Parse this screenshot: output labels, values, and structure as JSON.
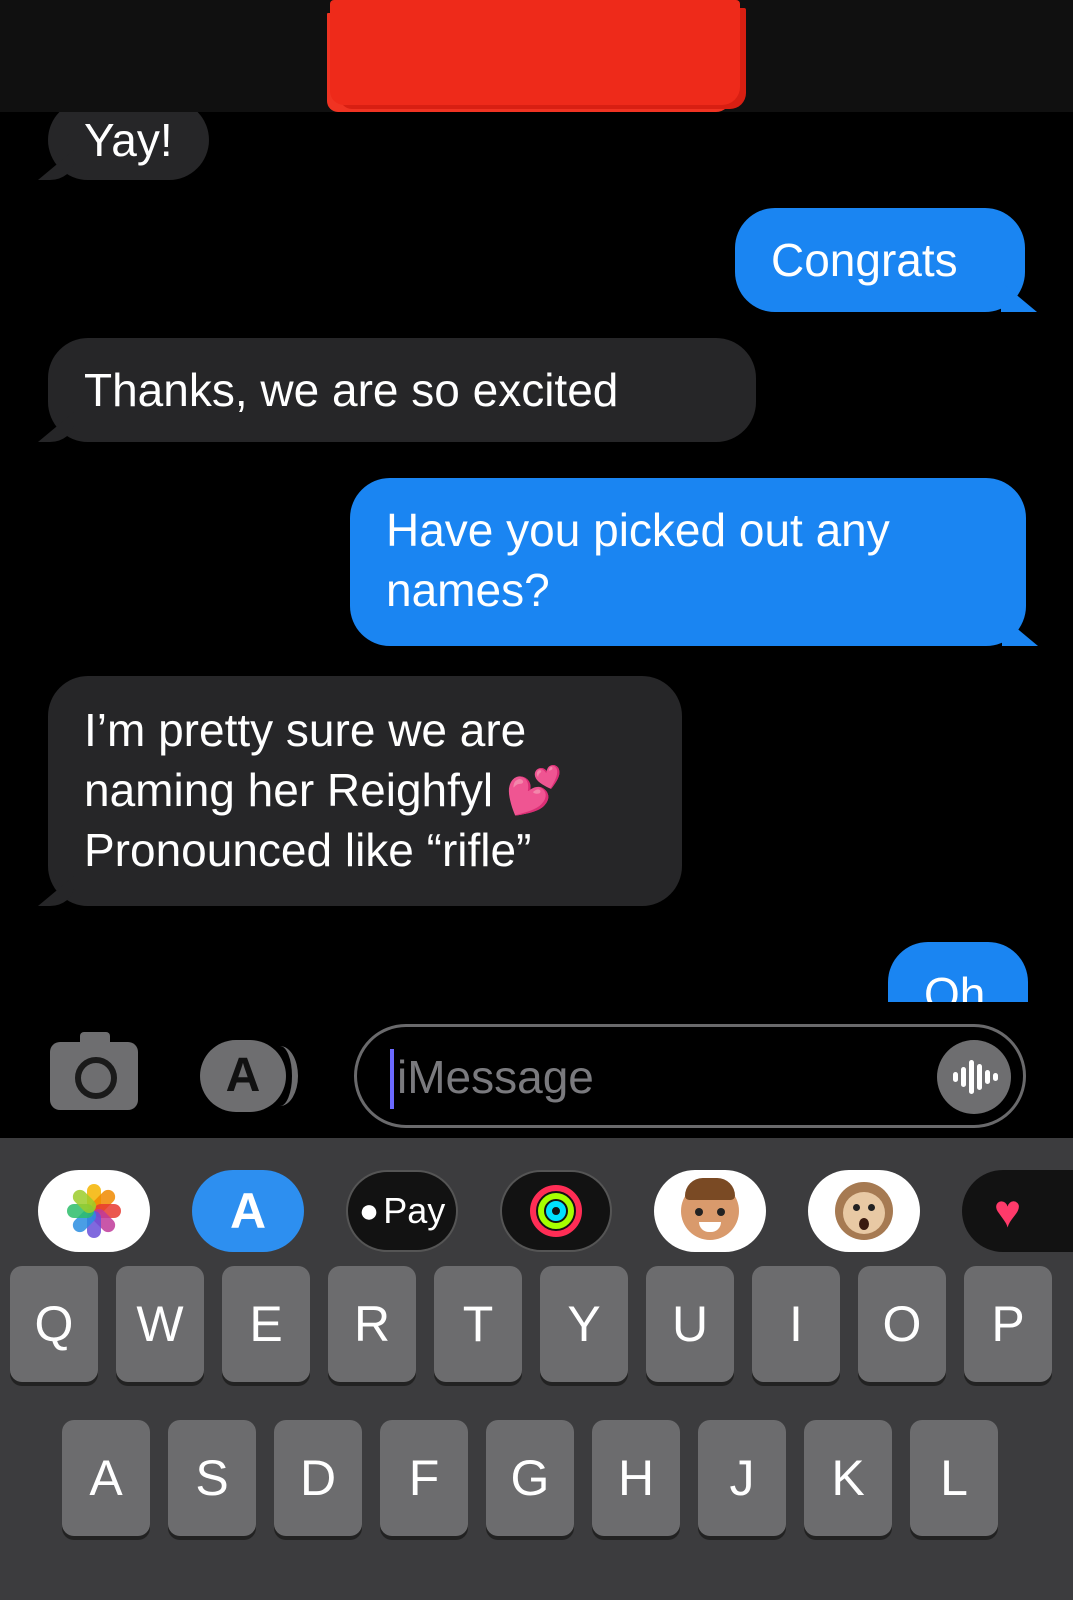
{
  "conversation": {
    "messages": [
      {
        "direction": "incoming",
        "text": "Yay!"
      },
      {
        "direction": "outgoing",
        "text": "Congrats"
      },
      {
        "direction": "incoming",
        "text": "Thanks, we are so excited"
      },
      {
        "direction": "outgoing",
        "text": "Have you picked out any names?"
      },
      {
        "direction": "incoming",
        "text": "I’m pretty sure we are naming her Reighfyl 💕 Pronounced like “rifle”"
      },
      {
        "direction": "outgoing",
        "text": "Oh"
      }
    ]
  },
  "input_bar": {
    "placeholder": "iMessage",
    "camera_icon": "camera-icon",
    "apps_icon": "app-store-icon",
    "voice_icon": "waveform-icon"
  },
  "app_drawer": {
    "apps": [
      {
        "name": "photos-icon"
      },
      {
        "name": "app-store-icon"
      },
      {
        "name": "apple-pay-icon",
        "label": "Pay"
      },
      {
        "name": "activity-rings-icon"
      },
      {
        "name": "memoji-icon"
      },
      {
        "name": "animoji-monkey-icon"
      },
      {
        "name": "digital-touch-heart-icon"
      }
    ]
  },
  "keyboard": {
    "row1": [
      "Q",
      "W",
      "E",
      "R",
      "T",
      "Y",
      "U",
      "I",
      "O",
      "P"
    ],
    "row2": [
      "A",
      "S",
      "D",
      "F",
      "G",
      "H",
      "J",
      "K",
      "L"
    ]
  },
  "colors": {
    "incoming_bubble": "#262628",
    "outgoing_bubble": "#1a85f2",
    "redaction": "#ee2a1a"
  }
}
